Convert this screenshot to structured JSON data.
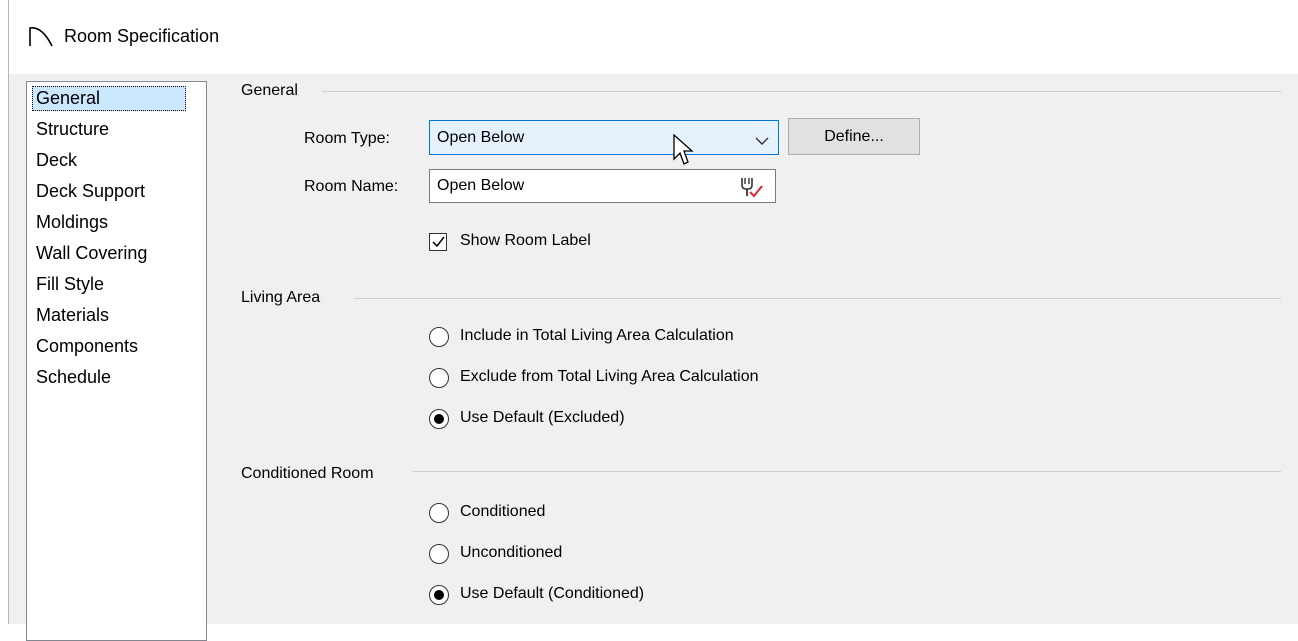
{
  "window": {
    "title": "Room Specification",
    "title_icon": "arc-icon"
  },
  "nav": {
    "items": [
      {
        "label": "General",
        "selected": true
      },
      {
        "label": "Structure"
      },
      {
        "label": "Deck"
      },
      {
        "label": "Deck Support"
      },
      {
        "label": "Moldings"
      },
      {
        "label": "Wall Covering"
      },
      {
        "label": "Fill Style"
      },
      {
        "label": "Materials"
      },
      {
        "label": "Components"
      },
      {
        "label": "Schedule"
      }
    ]
  },
  "general": {
    "title": "General",
    "room_type_label": "Room Type:",
    "room_type_value": "Open Below",
    "define_button": "Define...",
    "room_name_label": "Room Name:",
    "room_name_value": "Open Below",
    "show_room_label": "Show Room Label",
    "show_room_label_checked": true
  },
  "living_area": {
    "title": "Living Area",
    "options": [
      {
        "label": "Include in Total Living Area Calculation",
        "checked": false
      },
      {
        "label": "Exclude from Total Living Area Calculation",
        "checked": false
      },
      {
        "label": "Use Default (Excluded)",
        "checked": true
      }
    ]
  },
  "conditioned_room": {
    "title": "Conditioned Room",
    "options": [
      {
        "label": "Conditioned",
        "checked": false
      },
      {
        "label": "Unconditioned",
        "checked": false
      },
      {
        "label": "Use Default (Conditioned)",
        "checked": true
      }
    ]
  },
  "colors": {
    "selection": "#cce8ff",
    "focus_border": "#0078d7",
    "dialog_bg": "#f0f0f0",
    "check_accent": "#d9282f"
  }
}
